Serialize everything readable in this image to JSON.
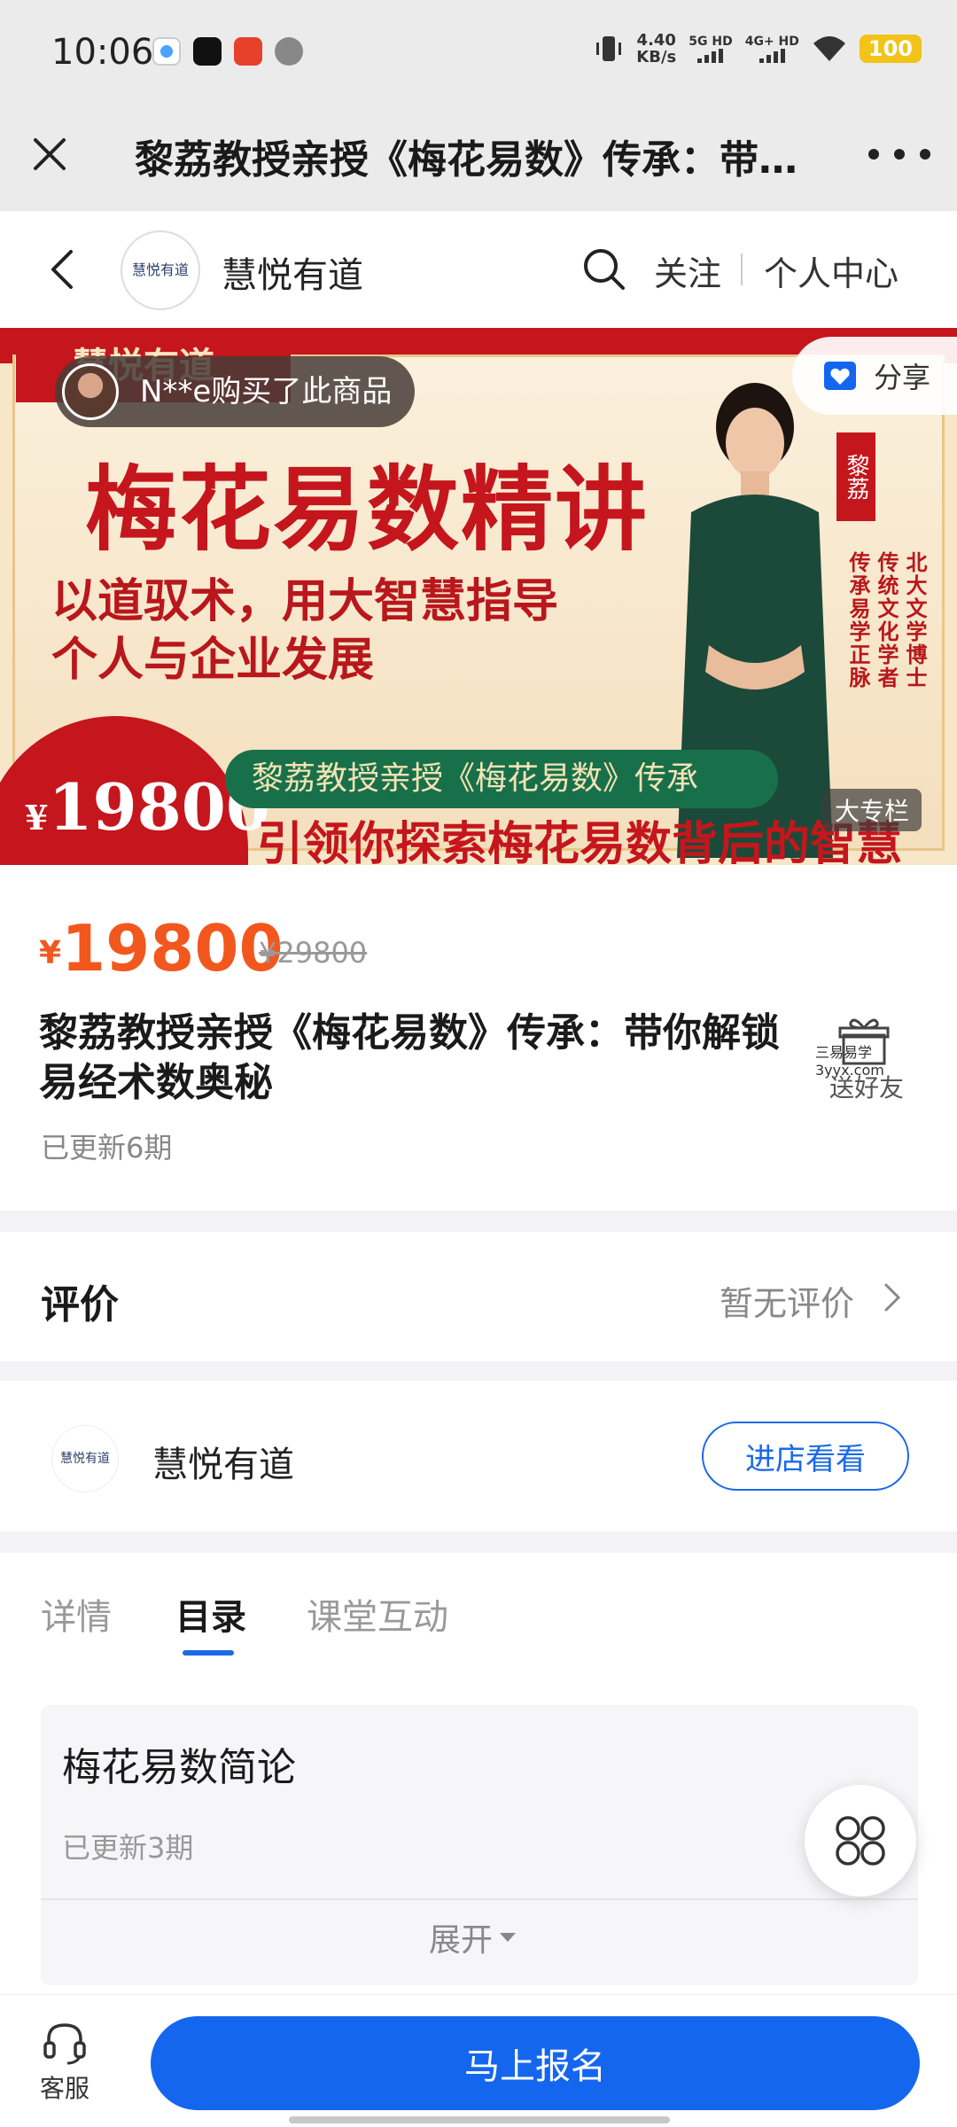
{
  "status_bar": {
    "time": "10:06",
    "net_speed_value": "4.40",
    "net_speed_unit": "KB/s",
    "sim1": "5G HD",
    "sim2": "4G+ HD",
    "battery": "100"
  },
  "title_bar": {
    "title": "黎荔教授亲授《梅花易数》传承：带你解锁易经术数奥秘"
  },
  "shop_header": {
    "logo_text": "慧悦有道",
    "shop_name": "慧悦有道",
    "follow": "关注",
    "personal_center": "个人中心"
  },
  "banner": {
    "tag": "慧悦有道",
    "buyer_toast": "N**e购买了此商品",
    "share": "分享",
    "headline": "梅花易数精讲",
    "sub_line1": "以道驭术，用大智慧指导",
    "sub_line2": "个人与企业发展",
    "presenter_name": "黎荔",
    "presenter_titles": [
      "北大文学博士",
      "传统文化学者",
      "传承易学正脉"
    ],
    "seal_currency": "¥",
    "seal_price": "19800",
    "pill_text": "黎荔教授亲授《梅花易数》传承",
    "bottom_text": "引领你探索梅花易数背后的智慧",
    "column_tag": "大专栏"
  },
  "product": {
    "currency": "¥",
    "price": "19800",
    "original_price": "¥29800",
    "title": "黎荔教授亲授《梅花易数》传承：带你解锁易经术数奥秘",
    "gift_label": "送好友",
    "watermark_line1": "三易易学",
    "watermark_line2": "3yyx.com",
    "updated": "已更新6期"
  },
  "reviews": {
    "label": "评价",
    "value": "暂无评价"
  },
  "shop_row": {
    "logo_text": "慧悦有道",
    "name": "慧悦有道",
    "enter_button": "进店看看"
  },
  "tabs": [
    {
      "label": "详情",
      "active": false
    },
    {
      "label": "目录",
      "active": true
    },
    {
      "label": "课堂互动",
      "active": false
    }
  ],
  "catalog": {
    "title": "梅花易数简论",
    "subtitle": "已更新3期",
    "expand": "展开"
  },
  "bottom_bar": {
    "customer_service": "客服",
    "signup": "马上报名"
  },
  "colors": {
    "accent_blue": "#1466ee",
    "price_orange": "#f2571e",
    "banner_red": "#c4161c"
  }
}
